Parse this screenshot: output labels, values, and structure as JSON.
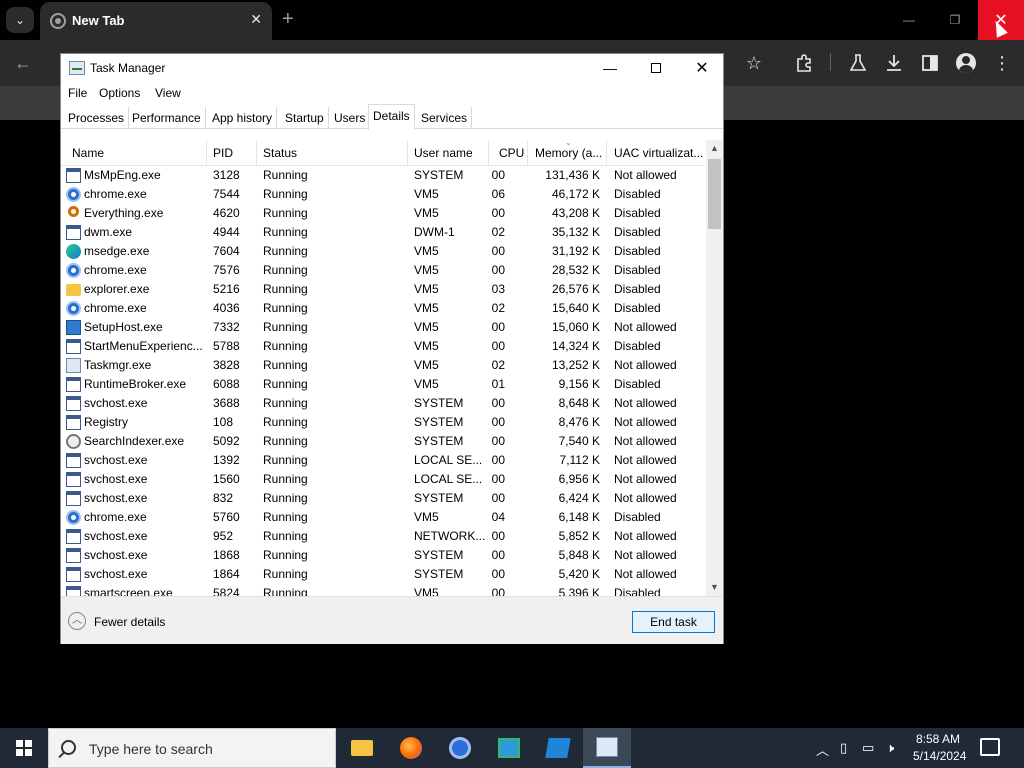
{
  "browser": {
    "tab_title": "New Tab",
    "tab_close": "✕",
    "new_tab": "+",
    "window_controls": {
      "minimize": "—",
      "restore": "❐",
      "close": "✕"
    },
    "toolbar_icons": [
      "back-icon",
      "star-icon",
      "extensions-icon",
      "labs-icon",
      "download-icon",
      "side-panel-icon",
      "profile-icon",
      "menu-icon"
    ]
  },
  "taskmgr": {
    "title": "Task Manager",
    "menus": [
      "File",
      "Options",
      "View"
    ],
    "tabs": [
      "Processes",
      "Performance",
      "App history",
      "Startup",
      "Users",
      "Details",
      "Services"
    ],
    "active_tab": "Details",
    "columns": [
      "Name",
      "PID",
      "Status",
      "User name",
      "CPU",
      "Memory (a...",
      "UAC virtualizat..."
    ],
    "rows": [
      {
        "name": "MsMpEng.exe",
        "pid": "3128",
        "status": "Running",
        "user": "SYSTEM",
        "cpu": "00",
        "memory": "131,436 K",
        "uac": "Not allowed",
        "icon": "blue-window"
      },
      {
        "name": "chrome.exe",
        "pid": "7544",
        "status": "Running",
        "user": "VM5",
        "cpu": "06",
        "memory": "46,172 K",
        "uac": "Disabled",
        "icon": "chrome"
      },
      {
        "name": "Everything.exe",
        "pid": "4620",
        "status": "Running",
        "user": "VM5",
        "cpu": "00",
        "memory": "43,208 K",
        "uac": "Disabled",
        "icon": "search"
      },
      {
        "name": "dwm.exe",
        "pid": "4944",
        "status": "Running",
        "user": "DWM-1",
        "cpu": "02",
        "memory": "35,132 K",
        "uac": "Disabled",
        "icon": "blue-window"
      },
      {
        "name": "msedge.exe",
        "pid": "7604",
        "status": "Running",
        "user": "VM5",
        "cpu": "00",
        "memory": "31,192 K",
        "uac": "Disabled",
        "icon": "edge"
      },
      {
        "name": "chrome.exe",
        "pid": "7576",
        "status": "Running",
        "user": "VM5",
        "cpu": "00",
        "memory": "28,532 K",
        "uac": "Disabled",
        "icon": "chrome"
      },
      {
        "name": "explorer.exe",
        "pid": "5216",
        "status": "Running",
        "user": "VM5",
        "cpu": "03",
        "memory": "26,576 K",
        "uac": "Disabled",
        "icon": "folder"
      },
      {
        "name": "chrome.exe",
        "pid": "4036",
        "status": "Running",
        "user": "VM5",
        "cpu": "02",
        "memory": "15,640 K",
        "uac": "Disabled",
        "icon": "chrome"
      },
      {
        "name": "SetupHost.exe",
        "pid": "7332",
        "status": "Running",
        "user": "VM5",
        "cpu": "00",
        "memory": "15,060 K",
        "uac": "Not allowed",
        "icon": "setup"
      },
      {
        "name": "StartMenuExperienc...",
        "pid": "5788",
        "status": "Running",
        "user": "VM5",
        "cpu": "00",
        "memory": "14,324 K",
        "uac": "Disabled",
        "icon": "blue-window"
      },
      {
        "name": "Taskmgr.exe",
        "pid": "3828",
        "status": "Running",
        "user": "VM5",
        "cpu": "02",
        "memory": "13,252 K",
        "uac": "Not allowed",
        "icon": "taskmgr"
      },
      {
        "name": "RuntimeBroker.exe",
        "pid": "6088",
        "status": "Running",
        "user": "VM5",
        "cpu": "01",
        "memory": "9,156 K",
        "uac": "Disabled",
        "icon": "blue-window"
      },
      {
        "name": "svchost.exe",
        "pid": "3688",
        "status": "Running",
        "user": "SYSTEM",
        "cpu": "00",
        "memory": "8,648 K",
        "uac": "Not allowed",
        "icon": "blue-window"
      },
      {
        "name": "Registry",
        "pid": "108",
        "status": "Running",
        "user": "SYSTEM",
        "cpu": "00",
        "memory": "8,476 K",
        "uac": "Not allowed",
        "icon": "blue-window"
      },
      {
        "name": "SearchIndexer.exe",
        "pid": "5092",
        "status": "Running",
        "user": "SYSTEM",
        "cpu": "00",
        "memory": "7,540 K",
        "uac": "Not allowed",
        "icon": "indexer"
      },
      {
        "name": "svchost.exe",
        "pid": "1392",
        "status": "Running",
        "user": "LOCAL SE...",
        "cpu": "00",
        "memory": "7,112 K",
        "uac": "Not allowed",
        "icon": "blue-window"
      },
      {
        "name": "svchost.exe",
        "pid": "1560",
        "status": "Running",
        "user": "LOCAL SE...",
        "cpu": "00",
        "memory": "6,956 K",
        "uac": "Not allowed",
        "icon": "blue-window"
      },
      {
        "name": "svchost.exe",
        "pid": "832",
        "status": "Running",
        "user": "SYSTEM",
        "cpu": "00",
        "memory": "6,424 K",
        "uac": "Not allowed",
        "icon": "blue-window"
      },
      {
        "name": "chrome.exe",
        "pid": "5760",
        "status": "Running",
        "user": "VM5",
        "cpu": "04",
        "memory": "6,148 K",
        "uac": "Disabled",
        "icon": "chrome"
      },
      {
        "name": "svchost.exe",
        "pid": "952",
        "status": "Running",
        "user": "NETWORK...",
        "cpu": "00",
        "memory": "5,852 K",
        "uac": "Not allowed",
        "icon": "blue-window"
      },
      {
        "name": "svchost.exe",
        "pid": "1868",
        "status": "Running",
        "user": "SYSTEM",
        "cpu": "00",
        "memory": "5,848 K",
        "uac": "Not allowed",
        "icon": "blue-window"
      },
      {
        "name": "svchost.exe",
        "pid": "1864",
        "status": "Running",
        "user": "SYSTEM",
        "cpu": "00",
        "memory": "5,420 K",
        "uac": "Not allowed",
        "icon": "blue-window"
      },
      {
        "name": "smartscreen.exe",
        "pid": "5824",
        "status": "Running",
        "user": "VM5",
        "cpu": "00",
        "memory": "5,396 K",
        "uac": "Disabled",
        "icon": "blue-window"
      }
    ],
    "fewer_details": "Fewer details",
    "end_task": "End task"
  },
  "taskbar": {
    "search_placeholder": "Type here to search",
    "apps": [
      "file-explorer-icon",
      "firefox-icon",
      "chrome-icon",
      "app-icon",
      "app-icon",
      "task-manager-icon"
    ],
    "time": "8:58 AM",
    "date": "5/14/2024"
  },
  "colors": {
    "browser_close_hover": "#e81123",
    "selected_tab_border": "#d9d9d9",
    "end_task_border": "#0078d7"
  }
}
